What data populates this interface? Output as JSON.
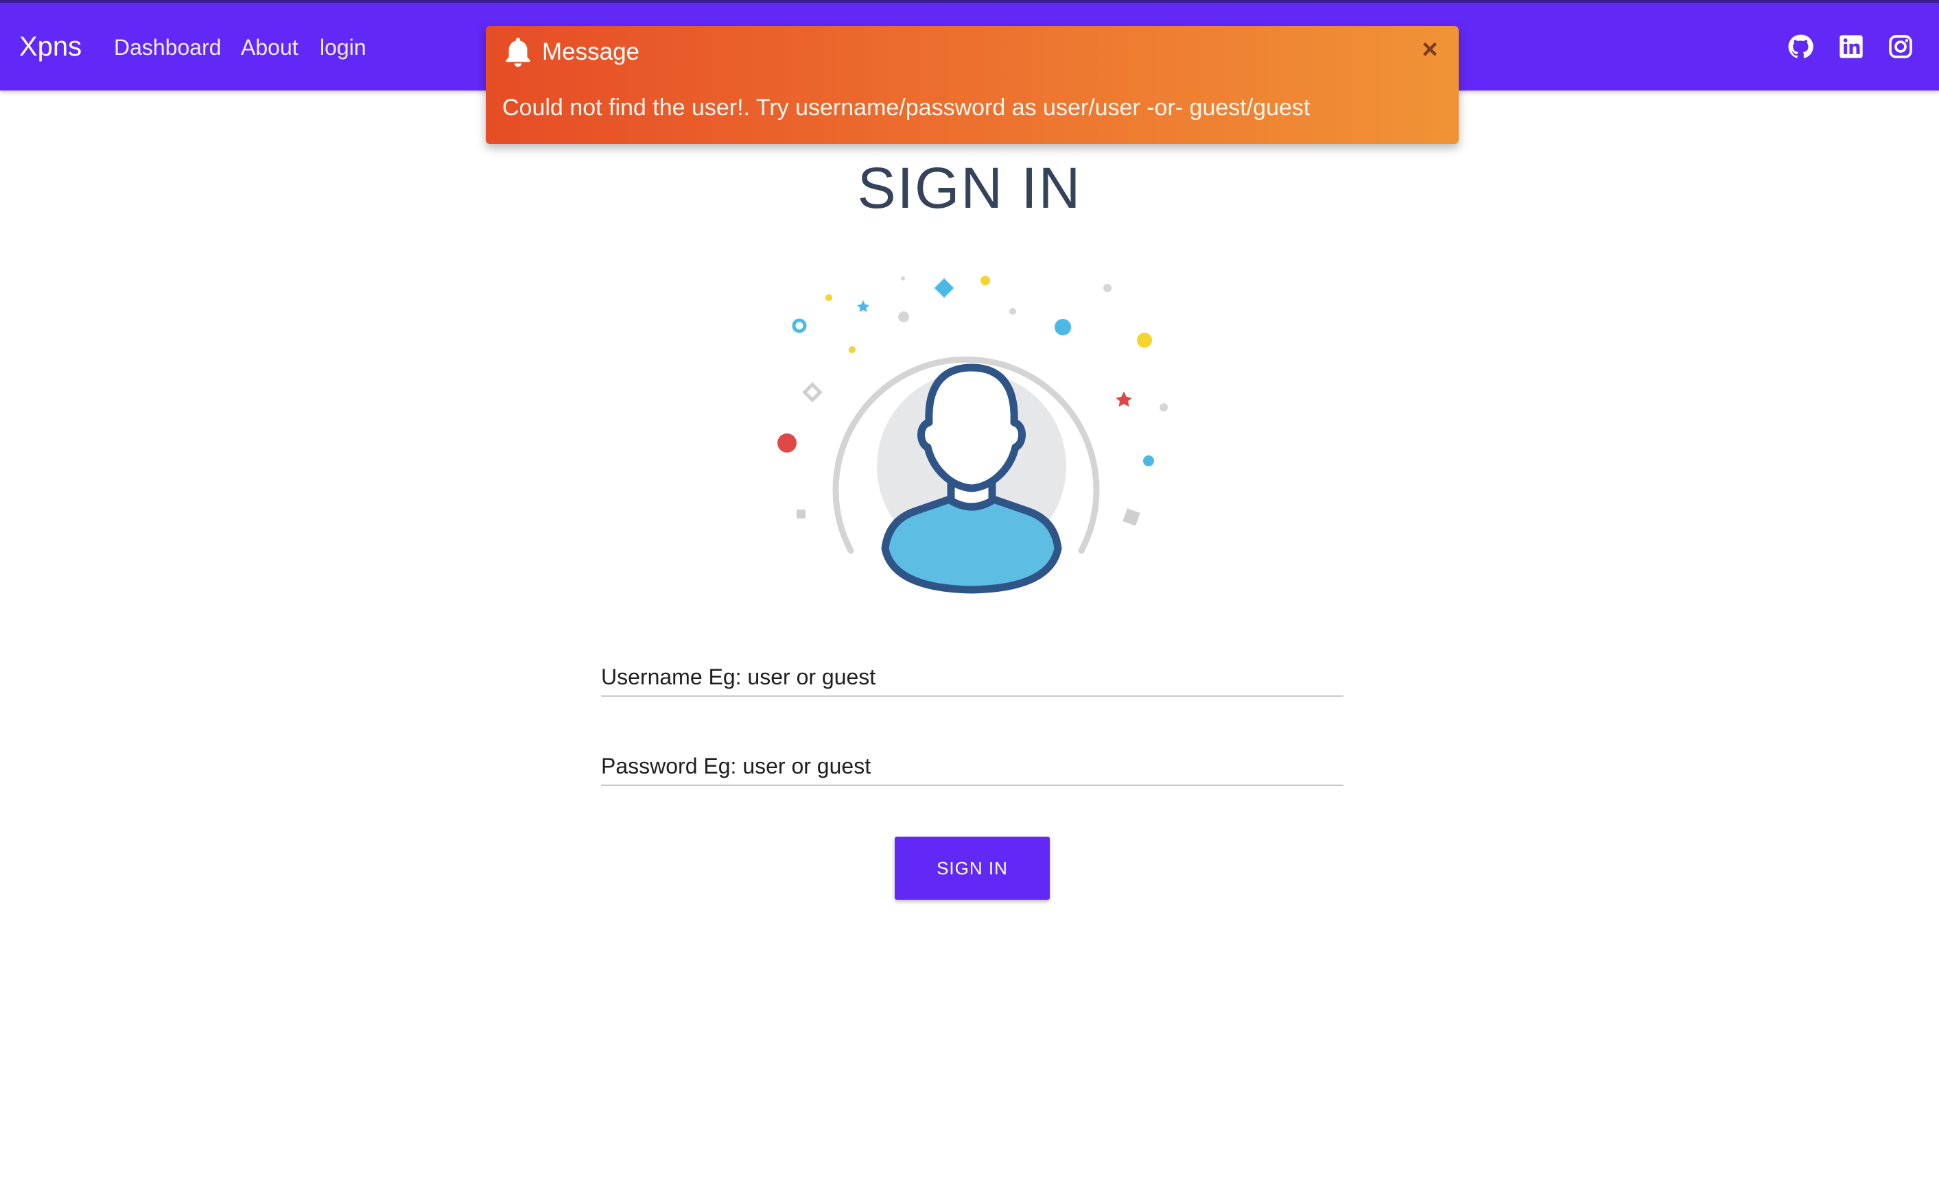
{
  "navbar": {
    "brand": "Xpns",
    "links": [
      "Dashboard",
      "About",
      "login"
    ],
    "social_icons": [
      "github-icon",
      "linkedin-icon",
      "instagram-icon"
    ],
    "color": "#6228f5"
  },
  "toast": {
    "icon": "bell-icon",
    "title": "Message",
    "message": "Could not find the user!. Try username/password as user/user -or- guest/guest",
    "close_icon": "close-icon",
    "gradient_colors": [
      "#e64d26",
      "#f09336"
    ]
  },
  "page": {
    "title": "SIGN IN",
    "illustration": "user-avatar-illustration"
  },
  "form": {
    "username_placeholder": "Username Eg: user or guest",
    "password_placeholder": "Password Eg: user or guest",
    "submit_label": "SIGN IN"
  }
}
